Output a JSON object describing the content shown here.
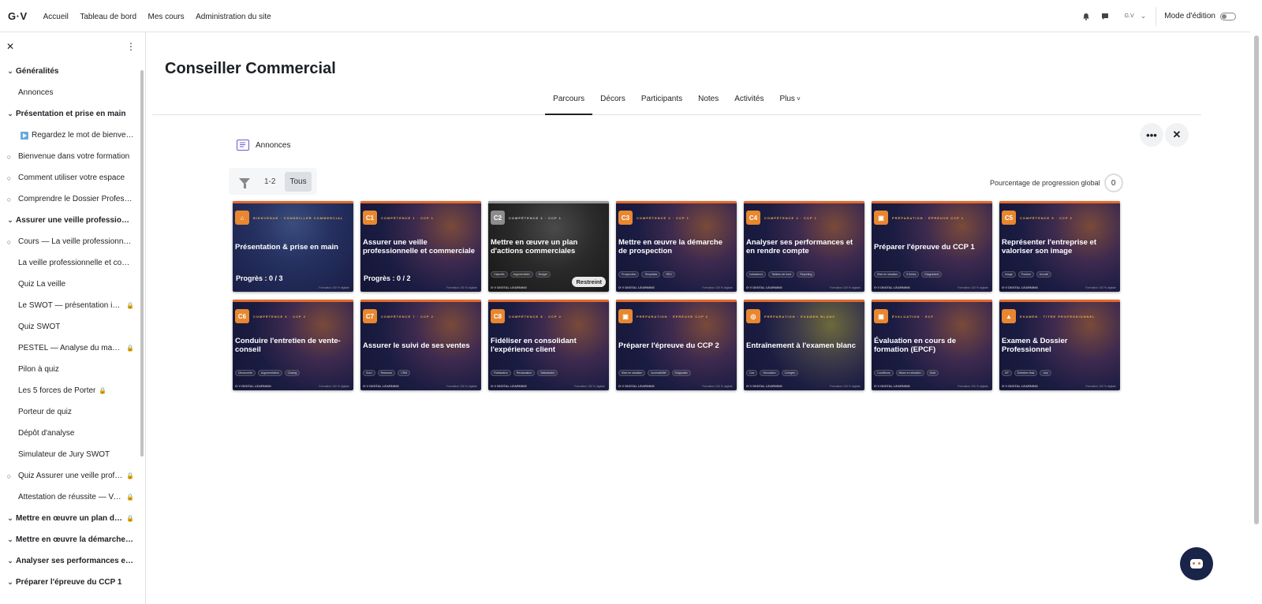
{
  "header": {
    "logo": "G·V",
    "nav": [
      "Accueil",
      "Tableau de bord",
      "Mes cours",
      "Administration du site"
    ],
    "user_initials": "G.V",
    "edit_mode_label": "Mode d'édition"
  },
  "sidebar": {
    "close_glyph": "✕",
    "menu_glyph": "⋮",
    "items": [
      {
        "type": "section",
        "label": "Généralités",
        "locked": false
      },
      {
        "type": "item",
        "label": "Annonces",
        "locked": false,
        "prefix": "none"
      },
      {
        "type": "section",
        "label": "Présentation et prise en main",
        "locked": false
      },
      {
        "type": "item",
        "label": "Regardez le mot de bienvenue",
        "locked": false,
        "prefix": "video"
      },
      {
        "type": "item",
        "label": "Bienvenue dans votre formation",
        "locked": false,
        "prefix": "circle"
      },
      {
        "type": "item",
        "label": "Comment utiliser votre espace",
        "locked": false,
        "prefix": "circle"
      },
      {
        "type": "item",
        "label": "Comprendre le Dossier Professionnel",
        "locked": false,
        "prefix": "circle"
      },
      {
        "type": "section",
        "label": "Assurer une veille professionnelle",
        "locked": false
      },
      {
        "type": "item",
        "label": "Cours — La veille professionnelle",
        "locked": false,
        "prefix": "circle"
      },
      {
        "type": "item",
        "label": "La veille professionnelle et commerciale",
        "locked": false,
        "prefix": "none"
      },
      {
        "type": "item",
        "label": "Quiz La veille",
        "locked": false,
        "prefix": "none"
      },
      {
        "type": "item",
        "label": "Le SWOT — présentation interactive",
        "locked": true,
        "prefix": "none"
      },
      {
        "type": "item",
        "label": "Quiz SWOT",
        "locked": false,
        "prefix": "none"
      },
      {
        "type": "item",
        "label": "PESTEL — Analyse du macro-environnement",
        "locked": true,
        "prefix": "none"
      },
      {
        "type": "item",
        "label": "Pilon à quiz",
        "locked": false,
        "prefix": "none"
      },
      {
        "type": "item",
        "label": "Les 5 forces de Porter",
        "locked": true,
        "prefix": "none"
      },
      {
        "type": "item",
        "label": "Porteur de quiz",
        "locked": false,
        "prefix": "none"
      },
      {
        "type": "item",
        "label": "Dépôt d'analyse",
        "locked": false,
        "prefix": "none"
      },
      {
        "type": "item",
        "label": "Simulateur de Jury SWOT",
        "locked": false,
        "prefix": "none"
      },
      {
        "type": "item",
        "label": "Quiz Assurer une veille professionnelle",
        "locked": true,
        "prefix": "circle"
      },
      {
        "type": "item",
        "label": "Attestation de réussite — Veille",
        "locked": true,
        "prefix": "none"
      },
      {
        "type": "section",
        "label": "Mettre en œuvre un plan d'actions",
        "locked": true
      },
      {
        "type": "section",
        "label": "Mettre en œuvre la démarche de prospection",
        "locked": false
      },
      {
        "type": "section",
        "label": "Analyser ses performances et en rendre compte",
        "locked": false
      },
      {
        "type": "section",
        "label": "Préparer l'épreuve du CCP 1",
        "locked": false
      }
    ]
  },
  "course": {
    "title": "Conseiller Commercial",
    "tabs": [
      "Parcours",
      "Décors",
      "Participants",
      "Notes",
      "Activités",
      "Plus"
    ],
    "active_tab": 0,
    "more_glyph": "•••",
    "close_glyph": "✕",
    "announcements_label": "Annonces",
    "filters": [
      "1-2",
      "Tous"
    ],
    "active_filter": 1,
    "progress_label": "Pourcentage de progression global",
    "progress_value": "0"
  },
  "cards": [
    {
      "badge": "⌂",
      "kicker": "BIENVENUE · CONSEILLER COMMERCIAL",
      "title": "Présentation & prise en main",
      "tags": [],
      "progress": "Progrès : 0 / 3",
      "restricted": "",
      "style": "first"
    },
    {
      "badge": "C1",
      "kicker": "COMPÉTENCE 1 · CCP 1",
      "title": "Assurer une veille professionnelle et commerciale",
      "tags": [],
      "progress": "Progrès : 0 / 2",
      "restricted": "",
      "style": "orange"
    },
    {
      "badge": "C2",
      "kicker": "COMPÉTENCE 2 · CCP 1",
      "title": "Mettre en œuvre un plan d'actions commerciales",
      "tags": [
        "Objectifs",
        "Argumentaire",
        "Budget"
      ],
      "progress": "",
      "restricted": "Restreint",
      "style": "grey"
    },
    {
      "badge": "C3",
      "kicker": "COMPÉTENCE 3 · CCP 1",
      "title": "Mettre en œuvre la démarche de prospection",
      "tags": [
        "Prospection",
        "Templates",
        "RDV"
      ],
      "progress": "",
      "restricted": "",
      "style": "orange"
    },
    {
      "badge": "C4",
      "kicker": "COMPÉTENCE 4 · CCP 1",
      "title": "Analyser ses performances et en rendre compte",
      "tags": [
        "Indicateurs",
        "Tableau de bord",
        "Reporting"
      ],
      "progress": "",
      "restricted": "",
      "style": "orange"
    },
    {
      "badge": "▣",
      "kicker": "PRÉPARATION · ÉPREUVE CCP 1",
      "title": "Préparer l'épreuve du CCP 1",
      "tags": [
        "Mise en situation",
        "5 fiches",
        "Diagramme"
      ],
      "progress": "",
      "restricted": "",
      "style": "orange"
    },
    {
      "badge": "C5",
      "kicker": "COMPÉTENCE 5 · CCP 2",
      "title": "Représenter l'entreprise et valoriser son image",
      "tags": [
        "Image",
        "Posture",
        "Accueil"
      ],
      "progress": "",
      "restricted": "",
      "style": "orange"
    },
    {
      "badge": "C6",
      "kicker": "COMPÉTENCE 6 · CCP 2",
      "title": "Conduire l'entretien de vente-conseil",
      "tags": [
        "Découverte",
        "Argumentation",
        "Closing"
      ],
      "progress": "",
      "restricted": "",
      "style": "orange"
    },
    {
      "badge": "C7",
      "kicker": "COMPÉTENCE 7 · CCP 2",
      "title": "Assurer le suivi de ses ventes",
      "tags": [
        "Suivi",
        "Relances",
        "CRM"
      ],
      "progress": "",
      "restricted": "",
      "style": "orange"
    },
    {
      "badge": "C8",
      "kicker": "COMPÉTENCE 8 · CCP 2",
      "title": "Fidéliser en consolidant l'expérience client",
      "tags": [
        "Fidélisation",
        "Réclamation",
        "Satisfaction"
      ],
      "progress": "",
      "restricted": "",
      "style": "orange"
    },
    {
      "badge": "▣",
      "kicker": "PRÉPARATION · ÉPREUVE CCP 2",
      "title": "Préparer l'épreuve du CCP 2",
      "tags": [
        "Mise en situation",
        "Accessibilité",
        "Diagnostic"
      ],
      "progress": "",
      "restricted": "",
      "style": "orange"
    },
    {
      "badge": "◎",
      "kicker": "PRÉPARATION · EXAMEN BLANC",
      "title": "Entraînement à l'examen blanc",
      "tags": [
        "Cas",
        "Simulation",
        "Corrigés"
      ],
      "progress": "",
      "restricted": "",
      "style": "gold"
    },
    {
      "badge": "▣",
      "kicker": "ÉVALUATION · ECF",
      "title": "Évaluation en cours de formation (EPCF)",
      "tags": [
        "Conditions",
        "Mises en situation",
        "Suivi"
      ],
      "progress": "",
      "restricted": "",
      "style": "orange"
    },
    {
      "badge": "▲",
      "kicker": "EXAMEN · TITRE PROFESSIONNEL",
      "title": "Examen & Dossier Professionnel",
      "tags": [
        "DP",
        "Entretien final",
        "Jury"
      ],
      "progress": "",
      "restricted": "",
      "style": "orange"
    }
  ],
  "card_footer_brand": "G·V DIGITAL LEARNING",
  "card_footer_note": "Formation 100 % digitale"
}
